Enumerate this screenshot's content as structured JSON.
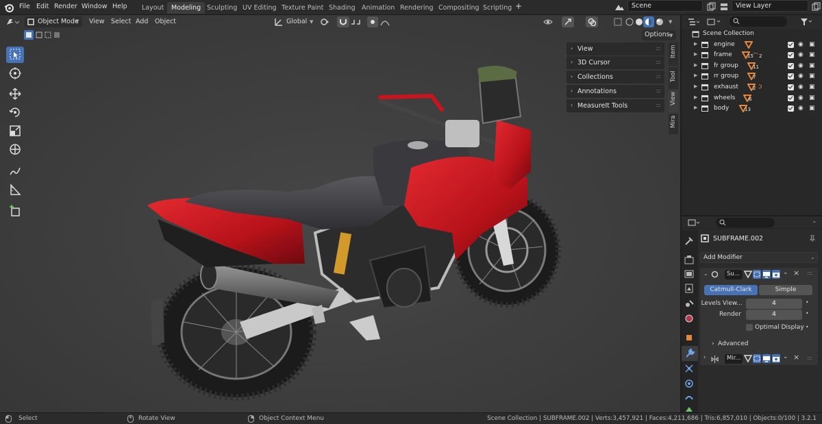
{
  "menu": {
    "file": "File",
    "edit": "Edit",
    "render": "Render",
    "window": "Window",
    "help": "Help"
  },
  "workspaces": [
    "Layout",
    "Modeling",
    "Sculpting",
    "UV Editing",
    "Texture Paint",
    "Shading",
    "Animation",
    "Rendering",
    "Compositing",
    "Scripting"
  ],
  "active_workspace": "Modeling",
  "add_workspace": "+",
  "scene_field": "Scene",
  "view_layer_field": "View Layer",
  "viewport_header": {
    "mode": "Object Mode",
    "view": "View",
    "select": "Select",
    "add": "Add",
    "object": "Object",
    "orientation": "Global",
    "options": "Options"
  },
  "npanel": {
    "sections": [
      "View",
      "3D Cursor",
      "Collections",
      "Annotations",
      "MeasureIt Tools"
    ],
    "tabs": [
      "Item",
      "Tool",
      "View",
      "Mira"
    ],
    "active_tab": "View"
  },
  "outliner": {
    "root": "Scene Collection",
    "collections": [
      {
        "name": "engine",
        "count": ""
      },
      {
        "name": "frame",
        "count": "15"
      },
      {
        "name": "fr group",
        "count": "11"
      },
      {
        "name": "rr group",
        "count": "7"
      },
      {
        "name": "exhaust",
        "count": "2"
      },
      {
        "name": "wheels",
        "count": "6"
      },
      {
        "name": "body",
        "count": "13"
      }
    ],
    "frame_extra_count": "2"
  },
  "properties": {
    "object_name": "SUBFRAME.002",
    "add_modifier": "Add Modifier",
    "modifier1": {
      "name": "Su...",
      "type_catmull": "Catmull-Clark",
      "type_simple": "Simple",
      "levels_label": "Levels View...",
      "levels_value": "4",
      "render_label": "Render",
      "render_value": "4",
      "optimal_display": "Optimal Display",
      "advanced": "Advanced"
    },
    "modifier2": {
      "name": "Mir..."
    }
  },
  "statusbar": {
    "select": "Select",
    "rotate": "Rotate View",
    "context": "Object Context Menu",
    "stats": "Scene Collection | SUBFRAME.002 | Verts:3,457,921 | Faces:4,211,686 | Tris:6,857,010 | Objects:0/100 | 3.2.1"
  },
  "colors": {
    "accent": "#4772b3",
    "viewport_bg": "#3f3f3f",
    "bike_red": "#c8141e",
    "collection_count": "#e3883d"
  }
}
